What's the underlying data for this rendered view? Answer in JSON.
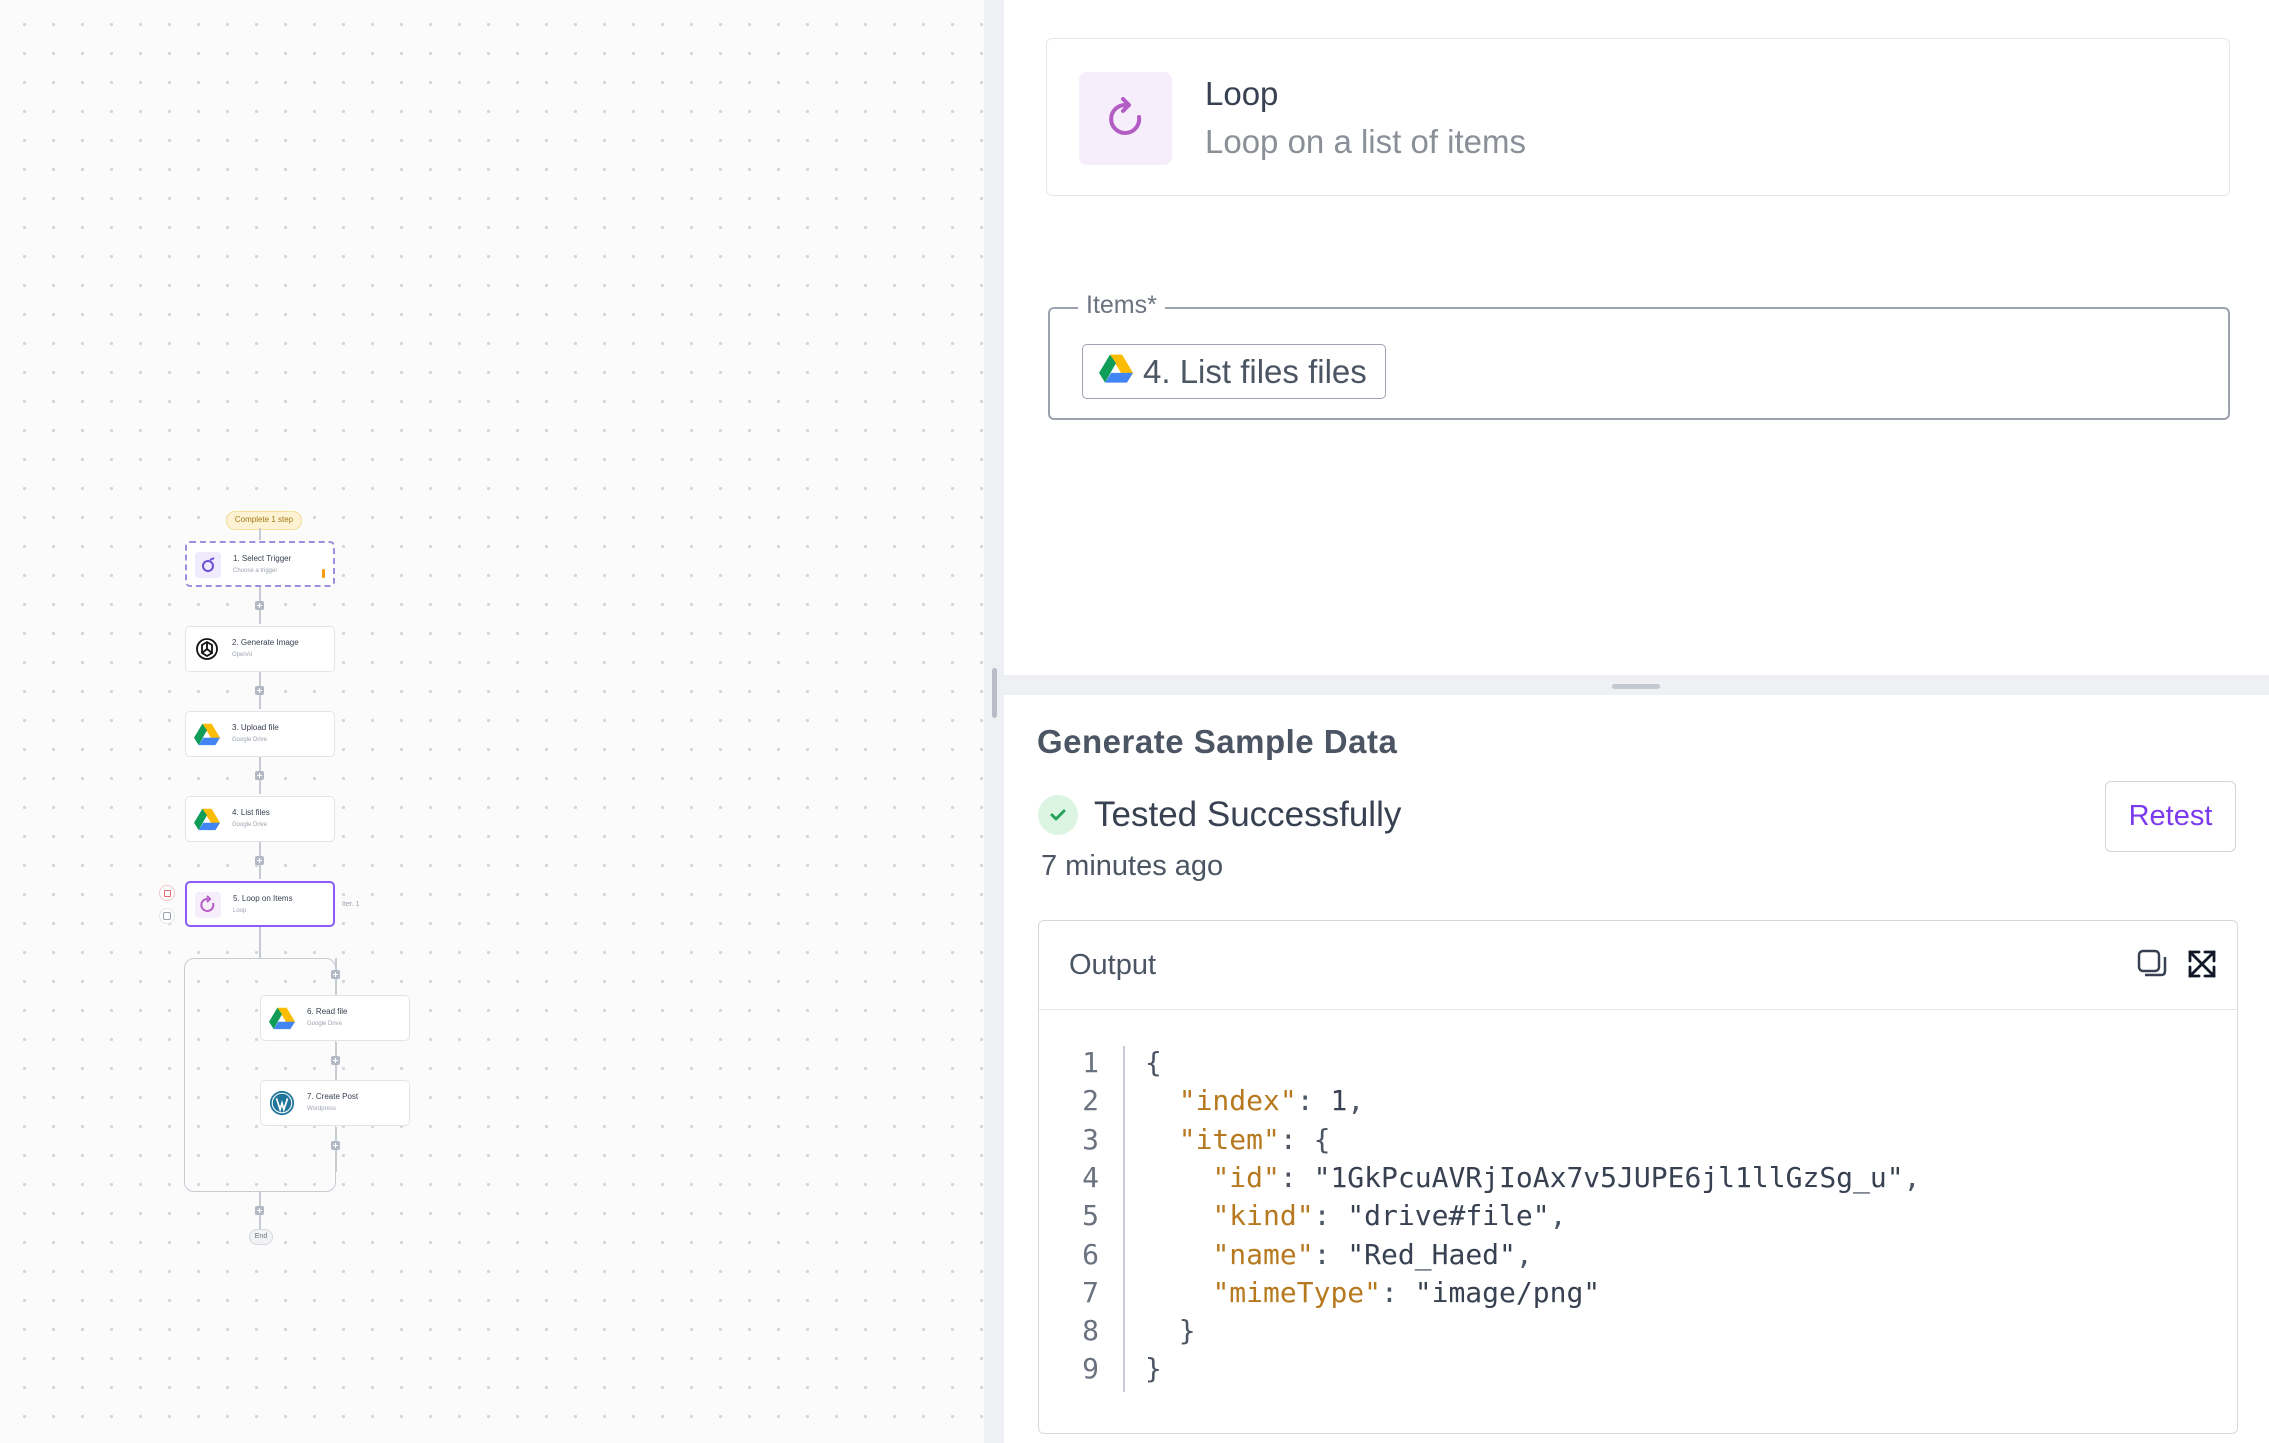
{
  "flow": {
    "badge": "Complete 1 step",
    "steps": [
      {
        "title": "1. Select Trigger",
        "subtitle": "Choose a trigger",
        "icon": "trigger-icon"
      },
      {
        "title": "2. Generate Image",
        "subtitle": "OpenAI",
        "icon": "openai-icon"
      },
      {
        "title": "3. Upload file",
        "subtitle": "Google Drive",
        "icon": "google-drive-icon"
      },
      {
        "title": "4. List files",
        "subtitle": "Google Drive",
        "icon": "google-drive-icon"
      },
      {
        "title": "5. Loop on Items",
        "subtitle": "Loop",
        "icon": "loop-icon"
      },
      {
        "title": "6. Read file",
        "subtitle": "Google Drive",
        "icon": "google-drive-icon"
      },
      {
        "title": "7. Create Post",
        "subtitle": "Wordpress",
        "icon": "wordpress-icon"
      }
    ],
    "iteration_label": "Iter. 1",
    "end_label": "End"
  },
  "piece": {
    "name": "Loop",
    "description": "Loop on a list of items",
    "icon": "loop-icon",
    "accent_color": "#b35cc4"
  },
  "items_field": {
    "label": "Items*",
    "chip_text": "4. List files files",
    "chip_icon": "google-drive-icon"
  },
  "sample": {
    "title": "Generate Sample Data",
    "status": "Tested Successfully",
    "time_ago": "7 minutes ago",
    "retest_label": "Retest",
    "output_label": "Output",
    "code_lines": [
      {
        "no": "1",
        "text": "{"
      },
      {
        "no": "2",
        "text": "  \"index\": 1,"
      },
      {
        "no": "3",
        "text": "  \"item\": {"
      },
      {
        "no": "4",
        "text": "    \"id\": \"1GkPcuAVRjIoAx7v5JUPE6jl1llGzSg_u\","
      },
      {
        "no": "5",
        "text": "    \"kind\": \"drive#file\","
      },
      {
        "no": "6",
        "text": "    \"name\": \"Red_Haed\","
      },
      {
        "no": "7",
        "text": "    \"mimeType\": \"image/png\""
      },
      {
        "no": "8",
        "text": "  }"
      },
      {
        "no": "9",
        "text": "}"
      }
    ]
  },
  "colors": {
    "accent": "#7c3aed",
    "success": "#22a35a",
    "json_key": "#b7791f",
    "json_string": "#1f9fc4",
    "json_number": "#b45309"
  }
}
